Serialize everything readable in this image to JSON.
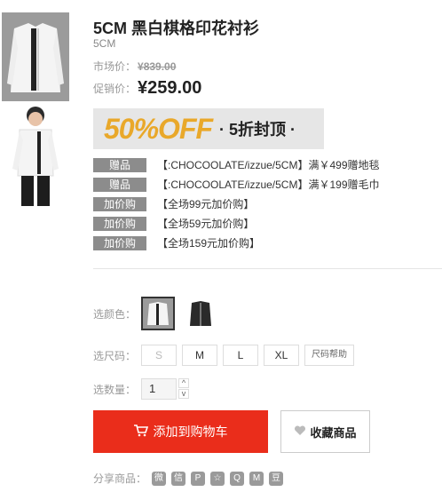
{
  "product": {
    "title": "5CM 黑白棋格印花衬衫",
    "brand": "5CM",
    "market_label": "市场价：",
    "market_price": "¥839.00",
    "sale_label": "促销价：",
    "sale_price": "¥259.00"
  },
  "banner": {
    "big_text": "50%OFF",
    "sub_text": "· 5折封顶 ·"
  },
  "promos": [
    {
      "tag": "赠品",
      "text": "【:CHOCOOLATE/izzue/5CM】满￥499赠地毯"
    },
    {
      "tag": "赠品",
      "text": "【:CHOCOOLATE/izzue/5CM】满￥199赠毛巾"
    },
    {
      "tag": "加价购",
      "text": "【全场99元加价购】"
    },
    {
      "tag": "加价购",
      "text": "【全场59元加价购】"
    },
    {
      "tag": "加价购",
      "text": "【全场159元加价购】"
    }
  ],
  "color": {
    "label": "选颜色："
  },
  "size": {
    "label": "选尺码：",
    "options": [
      "S",
      "M",
      "L",
      "XL"
    ],
    "help": "尺码帮助"
  },
  "quantity": {
    "label": "选数量：",
    "value": "1",
    "up": "^",
    "down": "v"
  },
  "actions": {
    "cart": "添加到购物车",
    "fav": "收藏商品"
  },
  "share": {
    "label": "分享商品：",
    "icons": [
      "微",
      "信",
      "P",
      "☆",
      "Q",
      "M",
      "豆"
    ]
  }
}
